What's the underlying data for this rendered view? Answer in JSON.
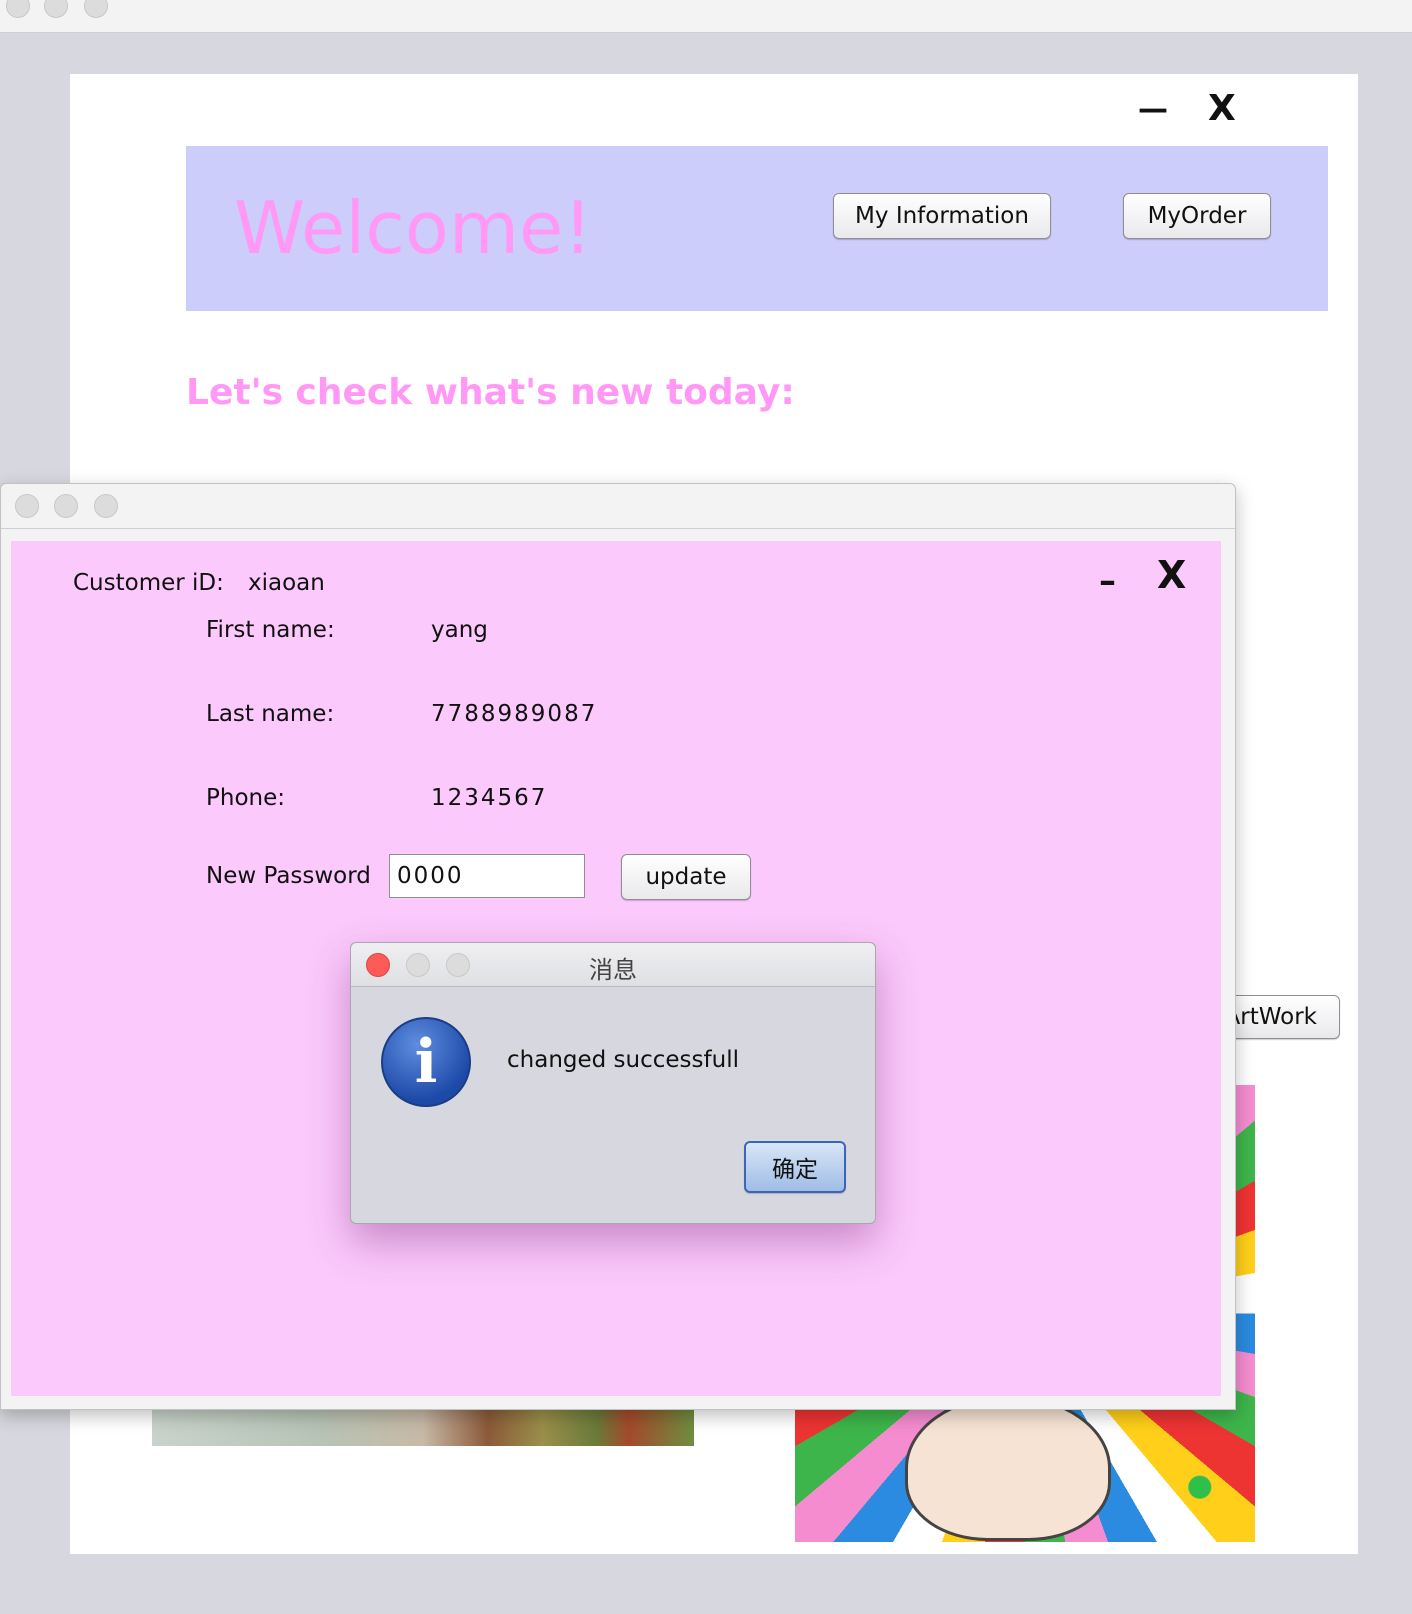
{
  "back_window": {
    "min_glyph": "—",
    "close_glyph": "X",
    "banner": {
      "welcome": "Welcome!",
      "my_information_label": "My Information",
      "my_order_label": "MyOrder"
    },
    "subtitle": "Let's check what's new today:",
    "artwork_label": "ArtWork"
  },
  "info_window": {
    "min_glyph": "–",
    "close_glyph": "X",
    "customer_id_label": "Customer iD:",
    "customer_id_value": "xiaoan",
    "first_name_label": "First name:",
    "first_name_value": "yang",
    "last_name_label": "Last name:",
    "last_name_value": "7788989087",
    "phone_label": "Phone:",
    "phone_value": "1234567",
    "new_password_label": "New Password",
    "new_password_value": "0000",
    "update_label": "update"
  },
  "dialog": {
    "title": "消息",
    "icon": "info-icon",
    "message": "changed successfull",
    "ok_label": "确定"
  },
  "colors": {
    "banner_bg": "#cccdfa",
    "accent_pink": "#ff99f5",
    "info_bg": "#fbc9fb"
  }
}
